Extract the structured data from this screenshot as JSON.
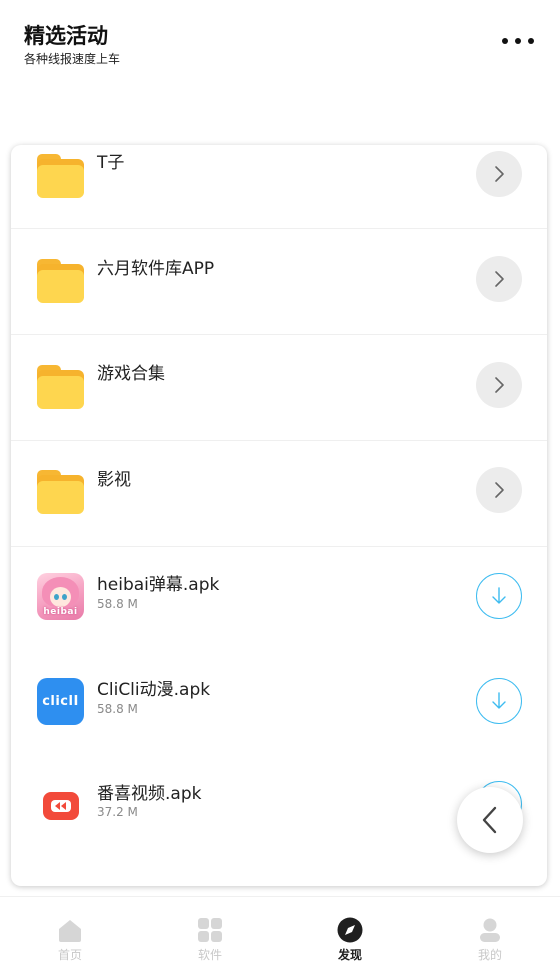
{
  "header": {
    "title": "精选活动",
    "subtitle": "各种线报速度上车"
  },
  "folders": [
    {
      "name": "T子"
    },
    {
      "name": "六月软件库APP"
    },
    {
      "name": "游戏合集"
    },
    {
      "name": "影视"
    }
  ],
  "files": [
    {
      "name": "heibai弹幕.apk",
      "size": "58.8 M",
      "icon": "heibai-app-icon",
      "icon_text": "heibai"
    },
    {
      "name": "CliCli动漫.apk",
      "size": "58.8 M",
      "icon": "clicli-app-icon",
      "icon_text": "cliclI"
    },
    {
      "name": "番喜视频.apk",
      "size": "37.2 M",
      "icon": "fanxi-app-icon"
    }
  ],
  "tabbar": {
    "items": [
      {
        "label": "首页",
        "icon": "home-icon",
        "active": false
      },
      {
        "label": "软件",
        "icon": "apps-grid-icon",
        "active": false
      },
      {
        "label": "发现",
        "icon": "compass-icon",
        "active": true
      },
      {
        "label": "我的",
        "icon": "profile-icon",
        "active": false
      }
    ]
  },
  "colors": {
    "accent_download": "#3ebcf0",
    "folder_yellow": "#fed64f",
    "folder_dark": "#f6b32d",
    "inactive_tab": "#c8c8c8",
    "active_tab": "#222222"
  }
}
